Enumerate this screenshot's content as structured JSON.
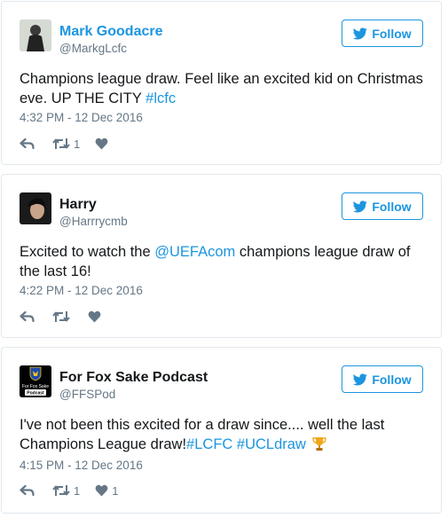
{
  "colors": {
    "link": "#1b95e0",
    "text": "#14171a",
    "muted": "#657786",
    "border": "#e1e8ed",
    "trophy": "#f0a81a"
  },
  "tweets": [
    {
      "name": "Mark Goodacre",
      "handle": "@MarkgLcfc",
      "follow_label": "Follow",
      "text": "Champions league draw. Feel like an excited kid on Christmas eve. UP THE CITY ",
      "hashtag": "#lcfc",
      "timestamp": "4:32 PM - 12 Dec 2016",
      "retweets": "1",
      "likes": ""
    },
    {
      "name": "Harry",
      "handle": "@Harrrycmb",
      "follow_label": "Follow",
      "text_before": "Excited to watch the ",
      "mention": "@UEFAcom",
      "text_after": " champions league draw of the last 16!",
      "timestamp": "4:22 PM - 12 Dec 2016",
      "retweets": "",
      "likes": ""
    },
    {
      "name": "For Fox Sake Podcast",
      "handle": "@FFSPod",
      "follow_label": "Follow",
      "avatar_text": [
        "For Fox Sake",
        "Podcast"
      ],
      "text": "I've not been this excited for a draw since.... well the last Champions League draw!",
      "hashtags": [
        "#LCFC",
        "#UCLdraw"
      ],
      "emoji": "trophy-icon",
      "timestamp": "4:15 PM - 12 Dec 2016",
      "retweets": "1",
      "likes": "1"
    }
  ]
}
